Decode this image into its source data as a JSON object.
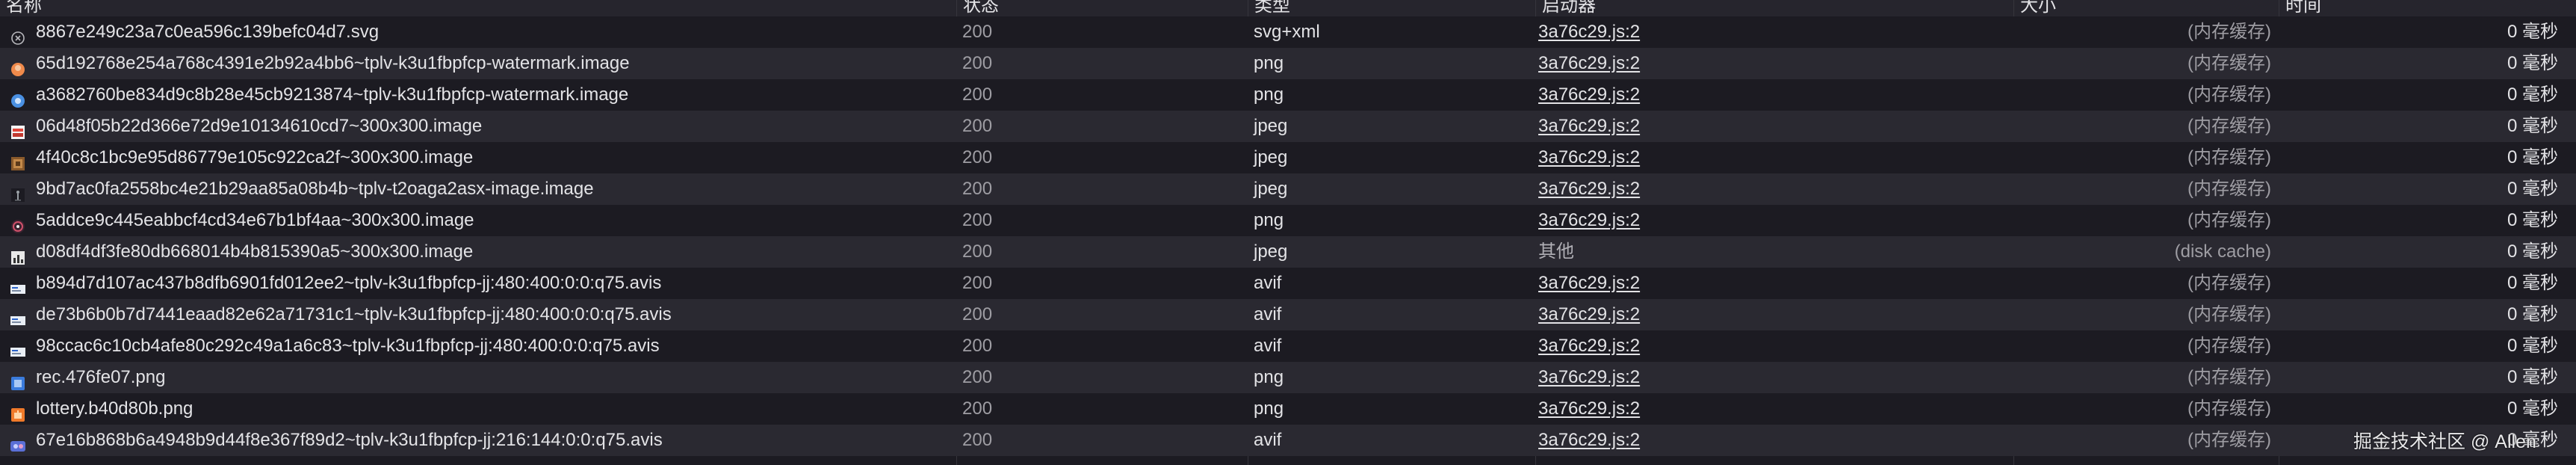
{
  "columns": {
    "name": "名称",
    "status": "状态",
    "type": "类型",
    "initiator": "启动器",
    "size": "大小",
    "time": "时间"
  },
  "rows": [
    {
      "name": "8867e249c23a7c0ea596c139befc04d7.svg",
      "icon": "svg-file-icon",
      "status": "200",
      "type": "svg+xml",
      "initiator": "3a76c29.js:2",
      "initiator_link": true,
      "size": "(内存缓存)",
      "time": "0 毫秒"
    },
    {
      "name": "65d192768e254a768c4391e2b92a4bb6~tplv-k3u1fbpfcp-watermark.image",
      "icon": "orange-circle-image-icon",
      "status": "200",
      "type": "png",
      "initiator": "3a76c29.js:2",
      "initiator_link": true,
      "size": "(内存缓存)",
      "time": "0 毫秒"
    },
    {
      "name": "a3682760be834d9c8b28e45cb9213874~tplv-k3u1fbpfcp-watermark.image",
      "icon": "blue-circle-image-icon",
      "status": "200",
      "type": "png",
      "initiator": "3a76c29.js:2",
      "initiator_link": true,
      "size": "(内存缓存)",
      "time": "0 毫秒"
    },
    {
      "name": "06d48f05b22d366e72d9e10134610cd7~300x300.image",
      "icon": "red-thumbnail-icon",
      "status": "200",
      "type": "jpeg",
      "initiator": "3a76c29.js:2",
      "initiator_link": true,
      "size": "(内存缓存)",
      "time": "0 毫秒"
    },
    {
      "name": "4f40c8c1bc9e95d86779e105c922ca2f~300x300.image",
      "icon": "brown-thumbnail-icon",
      "status": "200",
      "type": "jpeg",
      "initiator": "3a76c29.js:2",
      "initiator_link": true,
      "size": "(内存缓存)",
      "time": "0 毫秒"
    },
    {
      "name": "9bd7ac0fa2558bc4e21b29aa85a08b4b~tplv-t2oaga2asx-image.image",
      "icon": "figure-thumbnail-icon",
      "status": "200",
      "type": "jpeg",
      "initiator": "3a76c29.js:2",
      "initiator_link": true,
      "size": "(内存缓存)",
      "time": "0 毫秒"
    },
    {
      "name": "5addce9c445eabbcf4cd34e67b1bf4aa~300x300.image",
      "icon": "dark-circle-thumbnail-icon",
      "status": "200",
      "type": "png",
      "initiator": "3a76c29.js:2",
      "initiator_link": true,
      "size": "(内存缓存)",
      "time": "0 毫秒"
    },
    {
      "name": "d08df4df3fe80db668014b4b815390a5~300x300.image",
      "icon": "chart-thumbnail-icon",
      "status": "200",
      "type": "jpeg",
      "initiator": "其他",
      "initiator_link": false,
      "size": "(disk cache)",
      "time": "0 毫秒"
    },
    {
      "name": "b894d7d107ac437b8dfb6901fd012ee2~tplv-k3u1fbpfcp-jj:480:400:0:0:q75.avis",
      "icon": "banner-thumbnail-icon",
      "status": "200",
      "type": "avif",
      "initiator": "3a76c29.js:2",
      "initiator_link": true,
      "size": "(内存缓存)",
      "time": "0 毫秒"
    },
    {
      "name": "de73b6b0b7d7441eaad82e62a71731c1~tplv-k3u1fbpfcp-jj:480:400:0:0:q75.avis",
      "icon": "banner-thumbnail-icon",
      "status": "200",
      "type": "avif",
      "initiator": "3a76c29.js:2",
      "initiator_link": true,
      "size": "(内存缓存)",
      "time": "0 毫秒"
    },
    {
      "name": "98ccac6c10cb4afe80c292c49a1a6c83~tplv-k3u1fbpfcp-jj:480:400:0:0:q75.avis",
      "icon": "banner-thumbnail-icon",
      "status": "200",
      "type": "avif",
      "initiator": "3a76c29.js:2",
      "initiator_link": true,
      "size": "(内存缓存)",
      "time": "0 毫秒"
    },
    {
      "name": "rec.476fe07.png",
      "icon": "blue-square-image-icon",
      "status": "200",
      "type": "png",
      "initiator": "3a76c29.js:2",
      "initiator_link": true,
      "size": "(内存缓存)",
      "time": "0 毫秒"
    },
    {
      "name": "lottery.b40d80b.png",
      "icon": "orange-square-image-icon",
      "status": "200",
      "type": "png",
      "initiator": "3a76c29.js:2",
      "initiator_link": true,
      "size": "(内存缓存)",
      "time": "0 毫秒"
    },
    {
      "name": "67e16b868b6a4948b9d44f8e367f89d2~tplv-k3u1fbpfcp-jj:216:144:0:0:q75.avis",
      "icon": "avatar-thumbnail-icon",
      "status": "200",
      "type": "avif",
      "initiator": "3a76c29.js:2",
      "initiator_link": true,
      "size": "(内存缓存)",
      "time": "0 毫秒"
    }
  ],
  "watermark": "掘金技术社区 @ Allen",
  "colors": {
    "background": "#1c1b22",
    "row_alt": "#2a2931",
    "header": "#26252d",
    "text": "#e3e3e6",
    "muted": "#9e9da3"
  }
}
